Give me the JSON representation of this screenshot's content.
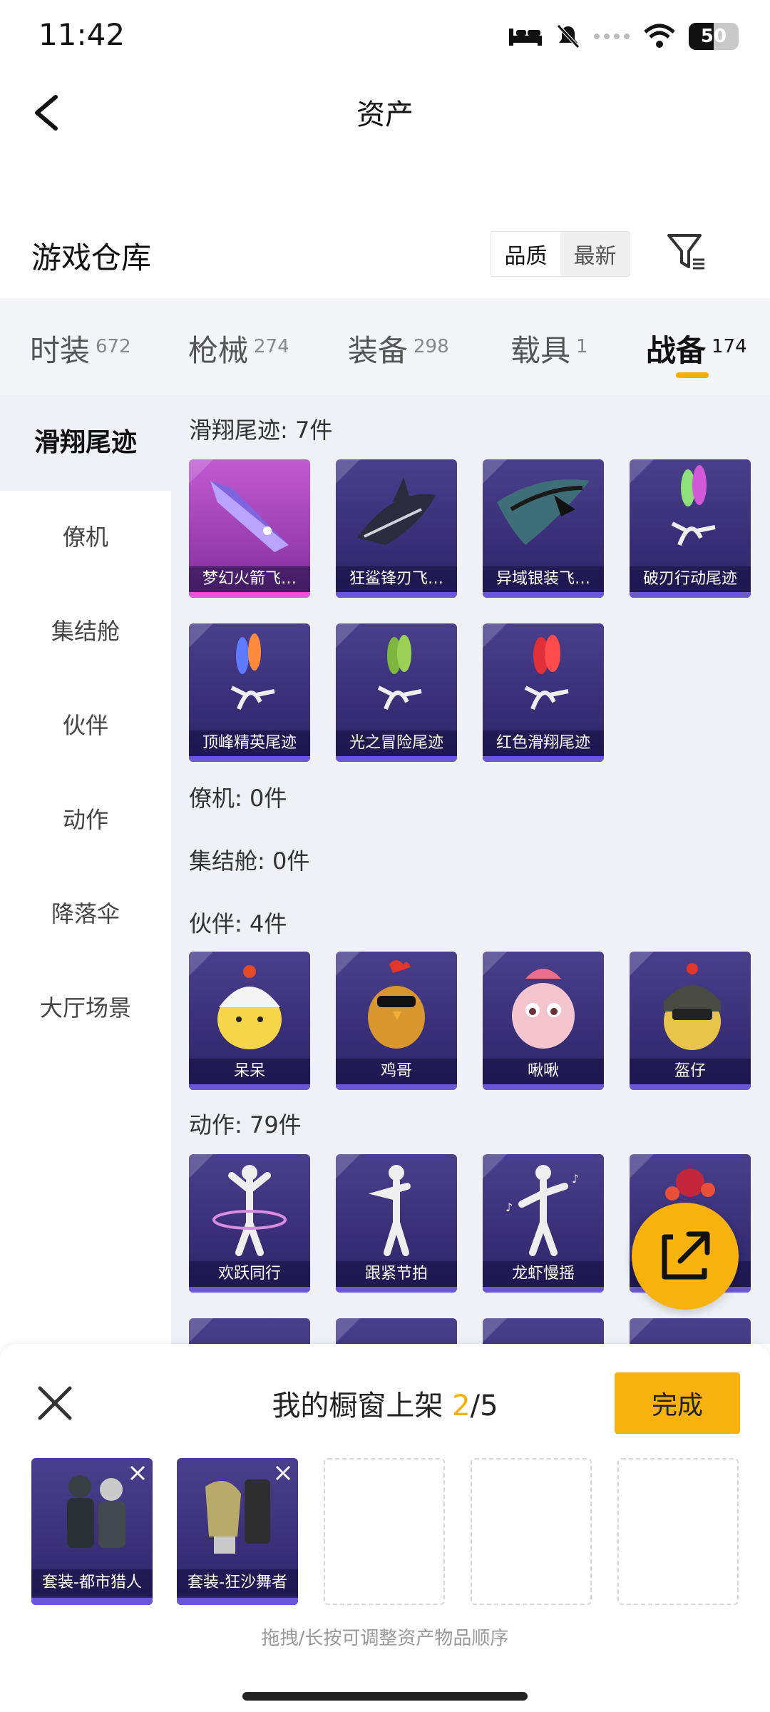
{
  "status_bar": {
    "time": "11:42",
    "battery": "50",
    "battery_level": 0.5
  },
  "header": {
    "title": "资产"
  },
  "section": {
    "title": "游戏仓库",
    "sort_options": [
      "品质",
      "最新"
    ],
    "sort_selected": "品质"
  },
  "tabs": [
    {
      "label": "时装",
      "count": "672"
    },
    {
      "label": "枪械",
      "count": "274"
    },
    {
      "label": "装备",
      "count": "298"
    },
    {
      "label": "载具",
      "count": "1"
    },
    {
      "label": "战备",
      "count": "174",
      "active": true
    }
  ],
  "sidebar": {
    "items": [
      "滑翔尾迹",
      "僚机",
      "集结舱",
      "伙伴",
      "动作",
      "降落伞",
      "大厅场景"
    ],
    "active": "滑翔尾迹"
  },
  "groups": {
    "glide_trails": {
      "title": "滑翔尾迹: 7件",
      "items": [
        "梦幻火箭飞…",
        "狂鲨锋刃飞…",
        "异域银装飞…",
        "破刃行动尾迹",
        "顶峰精英尾迹",
        "光之冒险尾迹",
        "红色滑翔尾迹"
      ]
    },
    "wingman": {
      "title": "僚机: 0件"
    },
    "pods": {
      "title": "集结舱: 0件"
    },
    "partners": {
      "title": "伙伴: 4件",
      "items": [
        "呆呆",
        "鸡哥",
        "啾啾",
        "盔仔"
      ]
    },
    "actions": {
      "title": "动作: 79件",
      "items": [
        "欢跃同行",
        "跟紧节拍",
        "龙虾慢摇",
        ""
      ]
    }
  },
  "showcase": {
    "title_prefix": "我的橱窗上架 ",
    "current": "2",
    "total": "/5",
    "done_label": "完成",
    "slots": [
      "套装-都市猎人",
      "套装-狂沙舞者",
      "",
      "",
      ""
    ],
    "hint": "拖拽/长按可调整资产物品顺序"
  },
  "icons": {
    "back": "back-arrow-icon",
    "filter": "filter-icon",
    "share": "share-export-icon",
    "close": "close-icon"
  },
  "colors": {
    "accent": "#f8b20e",
    "card_bg": "#3a2f78",
    "legendary": "#c05bd0"
  }
}
